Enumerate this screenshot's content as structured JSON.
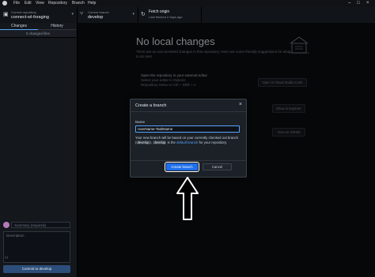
{
  "menu": [
    "File",
    "Edit",
    "View",
    "Repository",
    "Branch",
    "Help"
  ],
  "toolbar": {
    "repo_caption": "Current repository",
    "repo_name": "connect-wl-foraging",
    "branch_caption": "Current branch",
    "branch_name": "develop",
    "fetch_label": "Fetch origin",
    "fetch_status": "Last fetched 2 days ago"
  },
  "sidebar": {
    "tab_changes": "Changes",
    "tab_history": "History",
    "changed_files": "0 changed files",
    "summary_placeholder": "Summary (required)",
    "description_placeholder": "Description",
    "commit_button": "Commit to develop"
  },
  "main": {
    "title": "No local changes",
    "subtitle": "There are no uncommitted changes in this repository. Here are some friendly suggestions for what to do next.",
    "open_editor_title": "Open the repository in your external editor",
    "open_editor_sub": "Select your editor in Options",
    "open_editor_shortcut": "Repository menu or Ctrl + Shift + A",
    "open_editor_button": "Open in Visual Studio Code",
    "show_explorer_button": "Show in Explorer",
    "view_github_button": "View on GitHub"
  },
  "dialog": {
    "title": "Create a branch",
    "name_label": "Name",
    "name_value": "UserName-TaskName",
    "note_prefix": "Your new branch will be based on your currently checked out branch (",
    "note_branch1": "develop",
    "note_mid": "). ",
    "note_branch2": "develop",
    "note_is": " is the ",
    "note_link": "default branch",
    "note_suffix": " for your repository.",
    "create_button": "Create branch",
    "cancel_button": "Cancel"
  },
  "colors": {
    "accent": "#1f6feb",
    "background": "#0b0d10",
    "dialog": "#1c2128"
  }
}
